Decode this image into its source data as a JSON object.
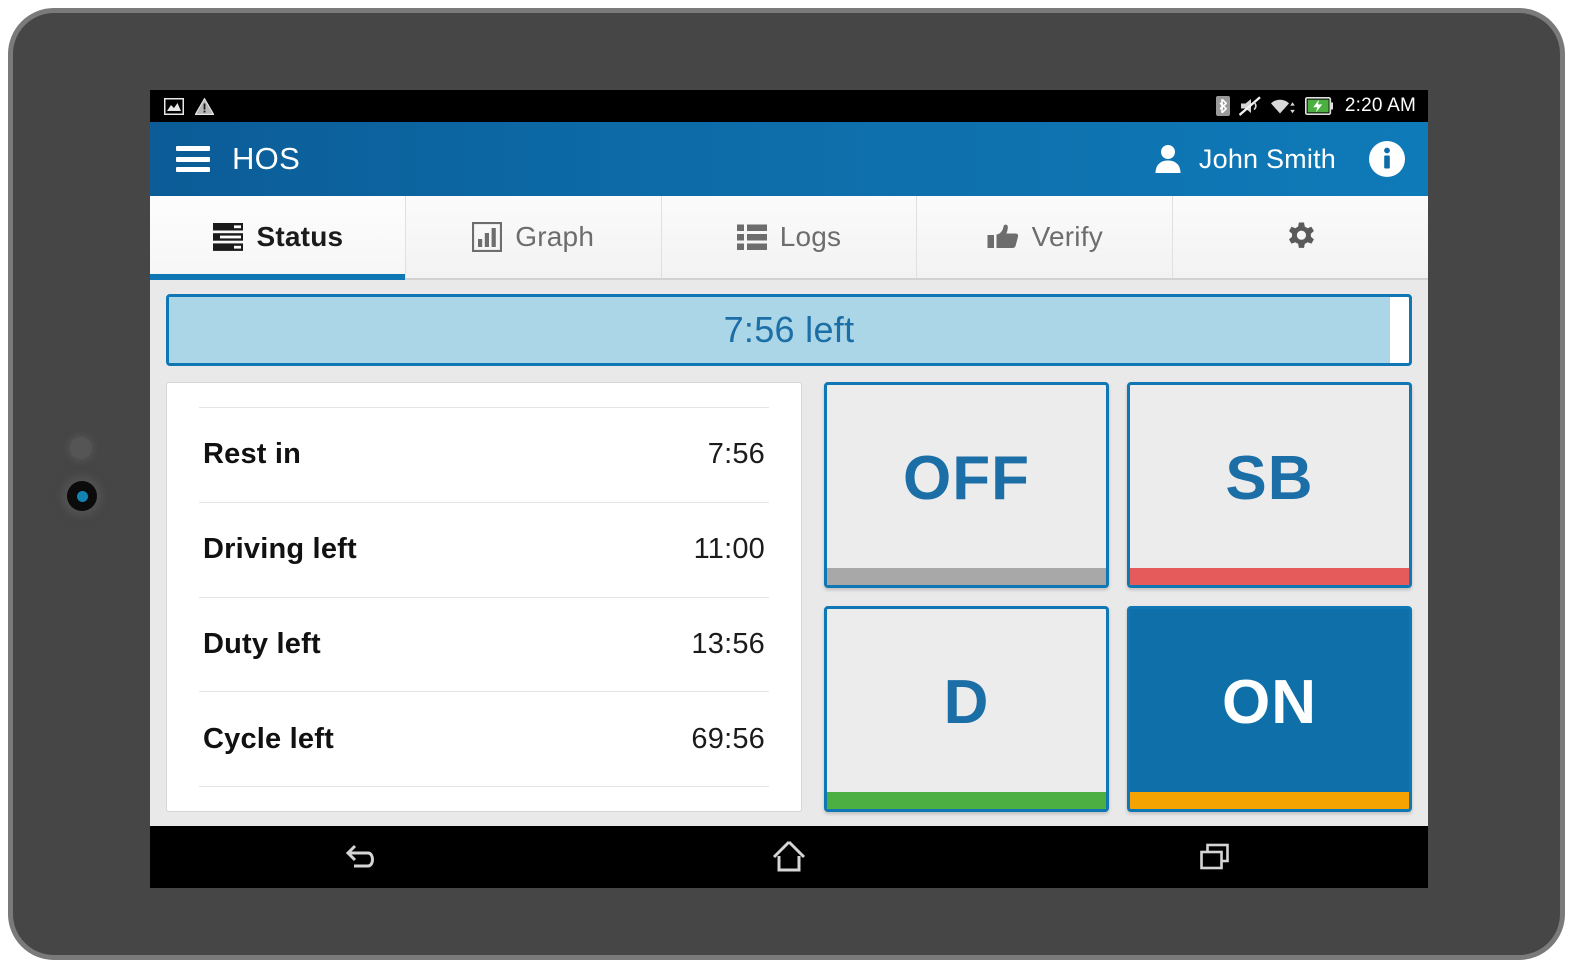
{
  "status_bar": {
    "left_icons": [
      "image-icon",
      "warning-icon"
    ],
    "right_icons": [
      "bluetooth-icon",
      "mute-icon",
      "wifi-icon",
      "battery-charging-icon"
    ],
    "clock": "2:20 AM"
  },
  "app_bar": {
    "menu_icon": "hamburger-menu-icon",
    "title": "HOS",
    "user_icon": "person-icon",
    "user_name": "John Smith",
    "info_icon": "info-icon"
  },
  "tabs": [
    {
      "label": "Status",
      "icon": "server-list-icon",
      "active": true
    },
    {
      "label": "Graph",
      "icon": "bar-chart-icon",
      "active": false
    },
    {
      "label": "Logs",
      "icon": "list-icon",
      "active": false
    },
    {
      "label": "Verify",
      "icon": "thumbs-up-icon",
      "active": false
    },
    {
      "label": "",
      "icon": "gear-icon",
      "active": false
    }
  ],
  "progress": {
    "label": "7:56 left",
    "fill_percent": 98.5,
    "fill_color": "#aad6e8",
    "border_color": "#0f78b4",
    "text_color": "#1b6ea6"
  },
  "status_table": {
    "rows": [
      {
        "label": "Rest in",
        "value": "7:56"
      },
      {
        "label": "Driving left",
        "value": "11:00"
      },
      {
        "label": "Duty left",
        "value": "13:56"
      },
      {
        "label": "Cycle left",
        "value": "69:56"
      }
    ]
  },
  "duty_buttons": [
    {
      "label": "OFF",
      "accent_color": "#a8a8a8",
      "selected": false
    },
    {
      "label": "SB",
      "accent_color": "#e55b5b",
      "selected": false
    },
    {
      "label": "D",
      "accent_color": "#4caf41",
      "selected": false
    },
    {
      "label": "ON",
      "accent_color": "#f5a303",
      "selected": true
    }
  ],
  "nav_bar": {
    "back_icon": "back-arrow-icon",
    "home_icon": "home-icon",
    "recents_icon": "recent-apps-icon"
  },
  "theme": {
    "accent_blue": "#0f78b4",
    "app_bar_blue": "#0d6ca8",
    "content_bg": "#e9e9e9"
  }
}
